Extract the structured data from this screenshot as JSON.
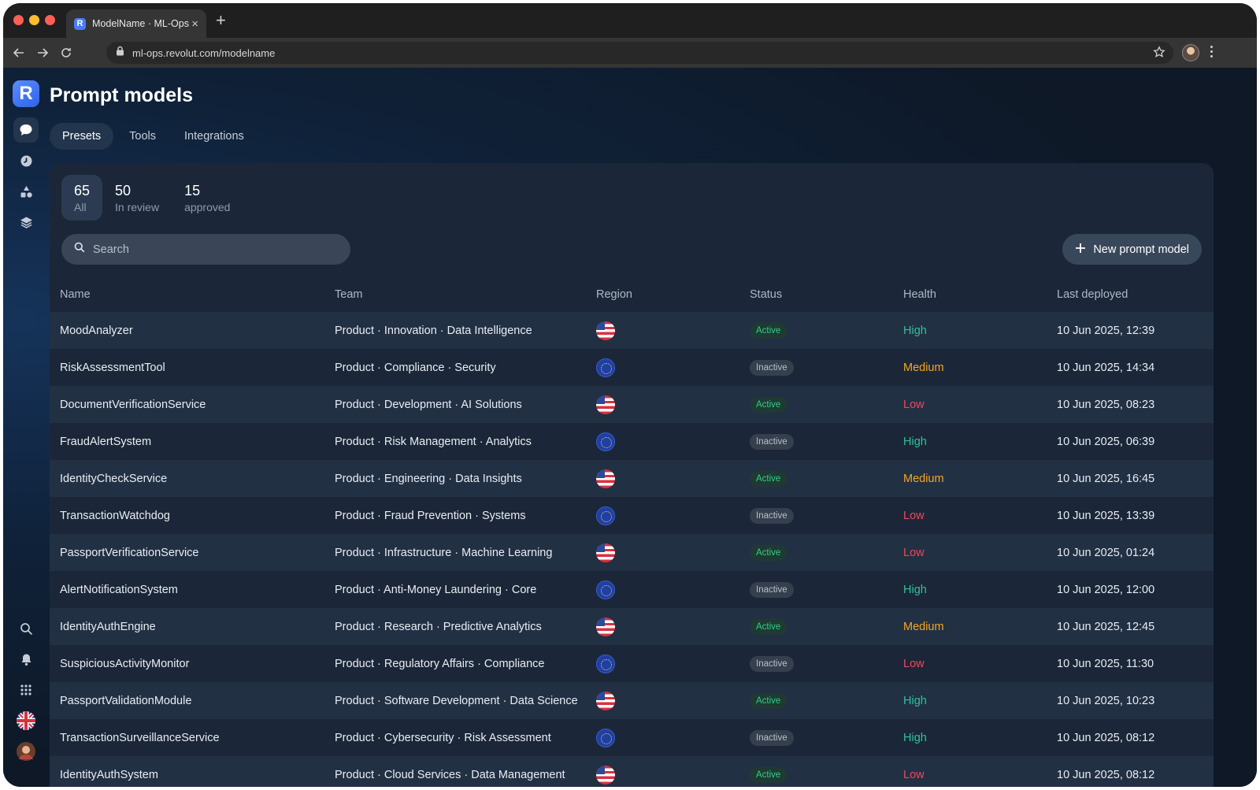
{
  "browser": {
    "tab_title": "ModelName · ML-Ops",
    "favicon_letter": "R",
    "url": "ml-ops.revolut.com/modelname"
  },
  "app": {
    "logo_letter": "R",
    "title": "Prompt models",
    "tabs": [
      "Presets",
      "Tools",
      "Integrations"
    ],
    "active_tab": "Presets",
    "counters": [
      {
        "value": "65",
        "label": "All"
      },
      {
        "value": "50",
        "label": "In review"
      },
      {
        "value": "15",
        "label": "approved"
      }
    ],
    "search_placeholder": "Search",
    "new_button_label": "New prompt model"
  },
  "sidebar": {
    "top_icons": [
      "chat-icon",
      "clock-icon",
      "shapes-icon",
      "layers-icon"
    ],
    "bottom_icons": [
      "search-icon",
      "bell-icon",
      "apps-grid-icon",
      "uk-flag-icon",
      "user-avatar"
    ]
  },
  "table": {
    "columns": [
      "Name",
      "Team",
      "Region",
      "Status",
      "Health",
      "Last deployed"
    ],
    "rows": [
      {
        "name": "MoodAnalyzer",
        "team": "Product · Innovation · Data Intelligence",
        "region": "us",
        "status": "Active",
        "health": "High",
        "deployed": "10 Jun 2025, 12:39"
      },
      {
        "name": "RiskAssessmentTool",
        "team": "Product · Compliance · Security",
        "region": "eu",
        "status": "Inactive",
        "health": "Medium",
        "deployed": "10 Jun 2025, 14:34"
      },
      {
        "name": "DocumentVerificationService",
        "team": "Product · Development · AI Solutions",
        "region": "us",
        "status": "Active",
        "health": "Low",
        "deployed": "10 Jun 2025, 08:23"
      },
      {
        "name": "FraudAlertSystem",
        "team": "Product · Risk Management · Analytics",
        "region": "eu",
        "status": "Inactive",
        "health": "High",
        "deployed": "10 Jun 2025, 06:39"
      },
      {
        "name": "IdentityCheckService",
        "team": "Product · Engineering · Data Insights",
        "region": "us",
        "status": "Active",
        "health": "Medium",
        "deployed": "10 Jun 2025, 16:45"
      },
      {
        "name": "TransactionWatchdog",
        "team": "Product · Fraud Prevention · Systems",
        "region": "eu",
        "status": "Inactive",
        "health": "Low",
        "deployed": "10 Jun 2025, 13:39"
      },
      {
        "name": "PassportVerificationService",
        "team": "Product · Infrastructure · Machine Learning",
        "region": "us",
        "status": "Active",
        "health": "Low",
        "deployed": "10 Jun 2025, 01:24"
      },
      {
        "name": "AlertNotificationSystem",
        "team": "Product · Anti-Money Laundering · Core",
        "region": "eu",
        "status": "Inactive",
        "health": "High",
        "deployed": "10 Jun 2025, 12:00"
      },
      {
        "name": "IdentityAuthEngine",
        "team": "Product · Research · Predictive Analytics",
        "region": "us",
        "status": "Active",
        "health": "Medium",
        "deployed": "10 Jun 2025, 12:45"
      },
      {
        "name": "SuspiciousActivityMonitor",
        "team": "Product · Regulatory Affairs · Compliance",
        "region": "eu",
        "status": "Inactive",
        "health": "Low",
        "deployed": "10 Jun 2025, 11:30"
      },
      {
        "name": "PassportValidationModule",
        "team": "Product · Software Development · Data Science",
        "region": "us",
        "status": "Active",
        "health": "High",
        "deployed": "10 Jun 2025, 10:23"
      },
      {
        "name": "TransactionSurveillanceService",
        "team": "Product · Cybersecurity · Risk Assessment",
        "region": "eu",
        "status": "Inactive",
        "health": "High",
        "deployed": "10 Jun 2025, 08:12"
      },
      {
        "name": "IdentityAuthSystem",
        "team": "Product · Cloud Services · Data Management",
        "region": "us",
        "status": "Active",
        "health": "Low",
        "deployed": "10 Jun 2025, 08:12"
      }
    ]
  },
  "colors": {
    "accent": "#4a7bf7",
    "health_high": "#2ec39a",
    "health_medium": "#f5a623",
    "health_low": "#f0475a",
    "status_active": "#2fcf88"
  }
}
